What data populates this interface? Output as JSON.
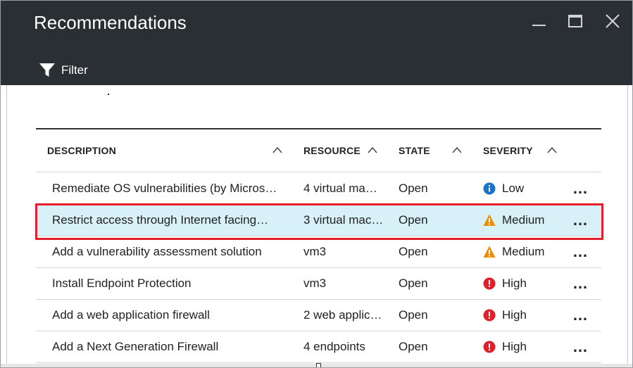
{
  "window": {
    "title": "Recommendations",
    "filter_label": "Filter"
  },
  "table": {
    "columns": [
      {
        "label": "DESCRIPTION"
      },
      {
        "label": "RESOURCE"
      },
      {
        "label": "STATE"
      },
      {
        "label": "SEVERITY"
      }
    ],
    "rows": [
      {
        "description": "Remediate OS vulnerabilities (by Micros…",
        "resource": "4 virtual ma…",
        "state": "Open",
        "severity": "Low",
        "severity_icon": "info-icon",
        "more": "…"
      },
      {
        "description": "Restrict access through Internet facing…",
        "resource": "3 virtual mac…",
        "state": "Open",
        "severity": "Medium",
        "severity_icon": "warning-icon",
        "more": "…"
      },
      {
        "description": "Add a vulnerability assessment solution",
        "resource": "vm3",
        "state": "Open",
        "severity": "Medium",
        "severity_icon": "warning-icon",
        "more": "…"
      },
      {
        "description": "Install Endpoint Protection",
        "resource": "vm3",
        "state": "Open",
        "severity": "High",
        "severity_icon": "error-icon",
        "more": "…"
      },
      {
        "description": "Add a web application firewall",
        "resource": "2 web applic…",
        "state": "Open",
        "severity": "High",
        "severity_icon": "error-icon",
        "more": "…"
      },
      {
        "description": "Add a Next Generation Firewall",
        "resource": "4 endpoints",
        "state": "Open",
        "severity": "High",
        "severity_icon": "error-icon",
        "more": "…"
      }
    ],
    "selected_row": 1
  },
  "colors": {
    "header_bg": "#2a2f33",
    "selected_row_bg": "#d8f0f8",
    "highlight_border": "#e3202b",
    "info": "#1a73c8",
    "warning": "#f08c00",
    "error": "#e0202b"
  }
}
